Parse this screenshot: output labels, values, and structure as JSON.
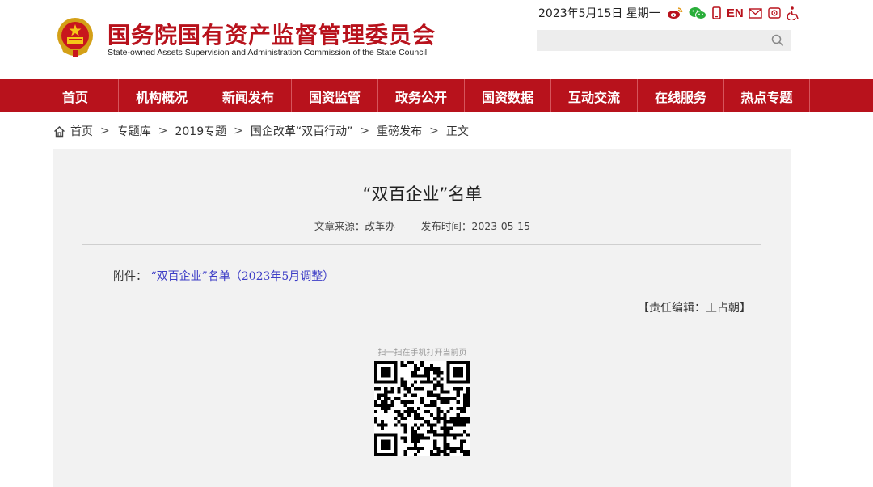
{
  "header": {
    "title_cn": "国务院国有资产监督管理委员会",
    "title_en": "State-owned Assets Supervision and Administration Commission of the State Council",
    "date": "2023年5月15日 星期一",
    "en_label": "EN",
    "tools": [
      "weibo-icon",
      "wechat-icon",
      "mobile-icon",
      "en-link",
      "mail-icon",
      "email-subscribe-icon",
      "accessibility-icon"
    ],
    "search_placeholder": ""
  },
  "nav": {
    "items": [
      "首页",
      "机构概况",
      "新闻发布",
      "国资监管",
      "政务公开",
      "国资数据",
      "互动交流",
      "在线服务",
      "热点专题"
    ]
  },
  "breadcrumb": {
    "items": [
      "首页",
      "专题库",
      "2019专题",
      "国企改革“双百行动”",
      "重磅发布",
      "正文"
    ],
    "separator": ">"
  },
  "article": {
    "title": "“双百企业”名单",
    "source": "文章来源：改革办",
    "published": "发布时间：2023-05-15",
    "attachment_label": "附件：",
    "attachment_link": "“双百企业”名单（2023年5月调整）",
    "editor": "【责任编辑：王占朝】",
    "qr_caption": "扫一扫在手机打开当前页"
  },
  "colors": {
    "brand_red": "#b8121c",
    "panel_bg": "#f2f2f2",
    "link_blue": "#3d3dc6"
  }
}
